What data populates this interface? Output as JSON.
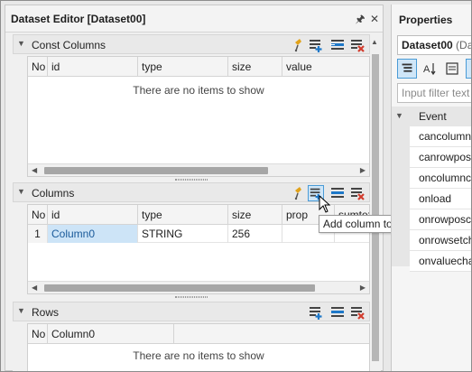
{
  "editor": {
    "title": "Dataset Editor [Dataset00]",
    "pin_glyph": "🖈",
    "close_glyph": "✕"
  },
  "const_columns": {
    "title": "Const Columns",
    "headers": [
      "No",
      "id",
      "type",
      "size",
      "value"
    ],
    "empty_message": "There are no items to show"
  },
  "columns": {
    "title": "Columns",
    "headers": [
      "No",
      "id",
      "type",
      "size",
      "prop",
      "sumtext"
    ],
    "rows": [
      {
        "no": "1",
        "id": "Column0",
        "type": "STRING",
        "size": "256",
        "prop": "",
        "sumtext": ""
      }
    ]
  },
  "rows": {
    "title": "Rows",
    "headers": [
      "No",
      "Column0"
    ],
    "empty_message": "There are no items to show"
  },
  "tooltip": {
    "text": "Add column to the dataset"
  },
  "properties": {
    "title": "Properties",
    "target_name": "Dataset00",
    "target_type": "(Da",
    "filter_placeholder": "Input filter text",
    "category": "Event",
    "items": [
      "cancolumnchange",
      "canrowposchange",
      "oncolumnchanged",
      "onload",
      "onrowposchanged",
      "onrowsetchanged",
      "onvaluechanged"
    ]
  },
  "colors": {
    "selected_cell": "#cde4f7",
    "active_button_border": "#4a9bd6",
    "add_icon_blue": "#1e78c8",
    "delete_icon_red": "#d23c2d",
    "filter_icon_yellow": "#e1a21a"
  }
}
